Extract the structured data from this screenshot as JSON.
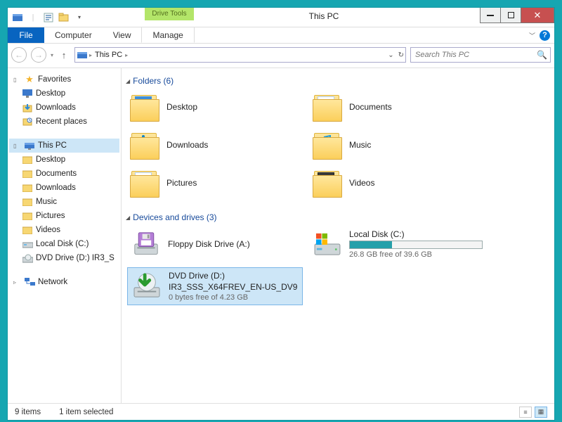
{
  "window_title": "This PC",
  "drive_tools_label": "Drive Tools",
  "ribbon": {
    "file": "File",
    "computer": "Computer",
    "view": "View",
    "manage": "Manage"
  },
  "address": {
    "root_label": "This PC"
  },
  "search": {
    "placeholder": "Search This PC"
  },
  "sidebar": {
    "favorites": {
      "label": "Favorites",
      "items": [
        {
          "label": "Desktop"
        },
        {
          "label": "Downloads"
        },
        {
          "label": "Recent places"
        }
      ]
    },
    "this_pc": {
      "label": "This PC",
      "items": [
        {
          "label": "Desktop"
        },
        {
          "label": "Documents"
        },
        {
          "label": "Downloads"
        },
        {
          "label": "Music"
        },
        {
          "label": "Pictures"
        },
        {
          "label": "Videos"
        },
        {
          "label": "Local Disk (C:)"
        },
        {
          "label": "DVD Drive (D:) IR3_S"
        }
      ]
    },
    "network": {
      "label": "Network"
    }
  },
  "sections": {
    "folders_header": "Folders (6)",
    "drives_header": "Devices and drives (3)"
  },
  "folders": [
    {
      "label": "Desktop"
    },
    {
      "label": "Documents"
    },
    {
      "label": "Downloads"
    },
    {
      "label": "Music"
    },
    {
      "label": "Pictures"
    },
    {
      "label": "Videos"
    }
  ],
  "drives": {
    "floppy": {
      "label": "Floppy Disk Drive (A:)"
    },
    "local": {
      "label": "Local Disk (C:)",
      "free_text": "26.8 GB free of 39.6 GB",
      "used_pct": 32
    },
    "dvd": {
      "label": "DVD Drive (D:)",
      "volume": "IR3_SSS_X64FREV_EN-US_DV9",
      "free_text": "0 bytes free of 4.23 GB"
    }
  },
  "status": {
    "count": "9 items",
    "selection": "1 item selected"
  }
}
